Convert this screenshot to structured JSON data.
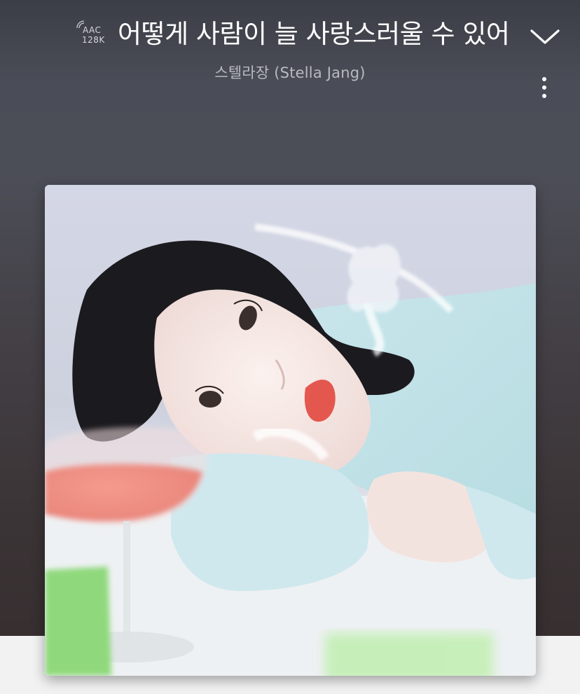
{
  "player": {
    "codec": {
      "format": "AAC",
      "bitrate": "128K"
    },
    "track_title": "어떻게 사람이 늘 사랑스러울 수 있어",
    "artist": "스텔라장 (Stella Jang)",
    "icons": {
      "collapse": "chevron-down-icon",
      "more": "more-vertical-icon",
      "codec": "signal-wave-icon"
    },
    "colors": {
      "title": "#ffffff",
      "artist": "#b9bac0",
      "background_top": "#4a4d57",
      "background_bottom": "#372f30",
      "strip": "#f2f2f2"
    }
  }
}
